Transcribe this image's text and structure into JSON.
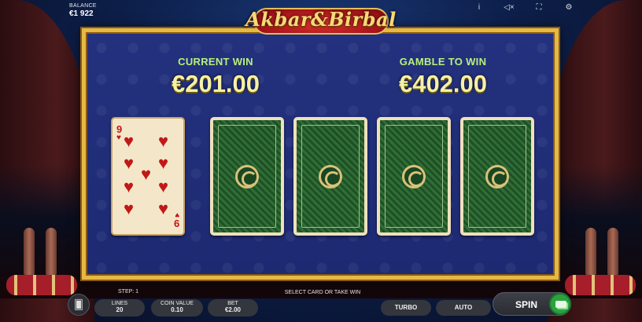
{
  "header": {
    "balance_label": "BALANCE",
    "balance_value": "€1 922",
    "icons": [
      "info-icon",
      "mute-icon",
      "fullscreen-icon",
      "settings-icon"
    ]
  },
  "logo": {
    "text": "Akbar&Birbal"
  },
  "gamble": {
    "current_win_label": "CURRENT WIN",
    "current_win_value": "€201.00",
    "gamble_label": "GAMBLE TO WIN",
    "gamble_value": "€402.00",
    "revealed_card": {
      "rank": "9",
      "suit": "hearts",
      "suit_glyph": "♥"
    },
    "face_down_cards": 4
  },
  "footer": {
    "step_text": "STEP: 1",
    "hint_text": "SELECT CARD OR TAKE WIN",
    "lines_label": "LINES",
    "lines_value": "20",
    "coin_label": "COIN VALUE",
    "coin_value": "0.10",
    "bet_label": "BET",
    "bet_value": "€2.00",
    "turbo_label": "TURBO",
    "auto_label": "AUTO",
    "spin_label": "SPIN"
  },
  "colors": {
    "panel_bg": "#1d2a72",
    "panel_border": "#e6b947",
    "win_label": "#b8f07a",
    "win_value": "#f4f0a8",
    "card_back": "#245a2b",
    "heart": "#c21818",
    "spin_accent": "#2aa33f"
  }
}
